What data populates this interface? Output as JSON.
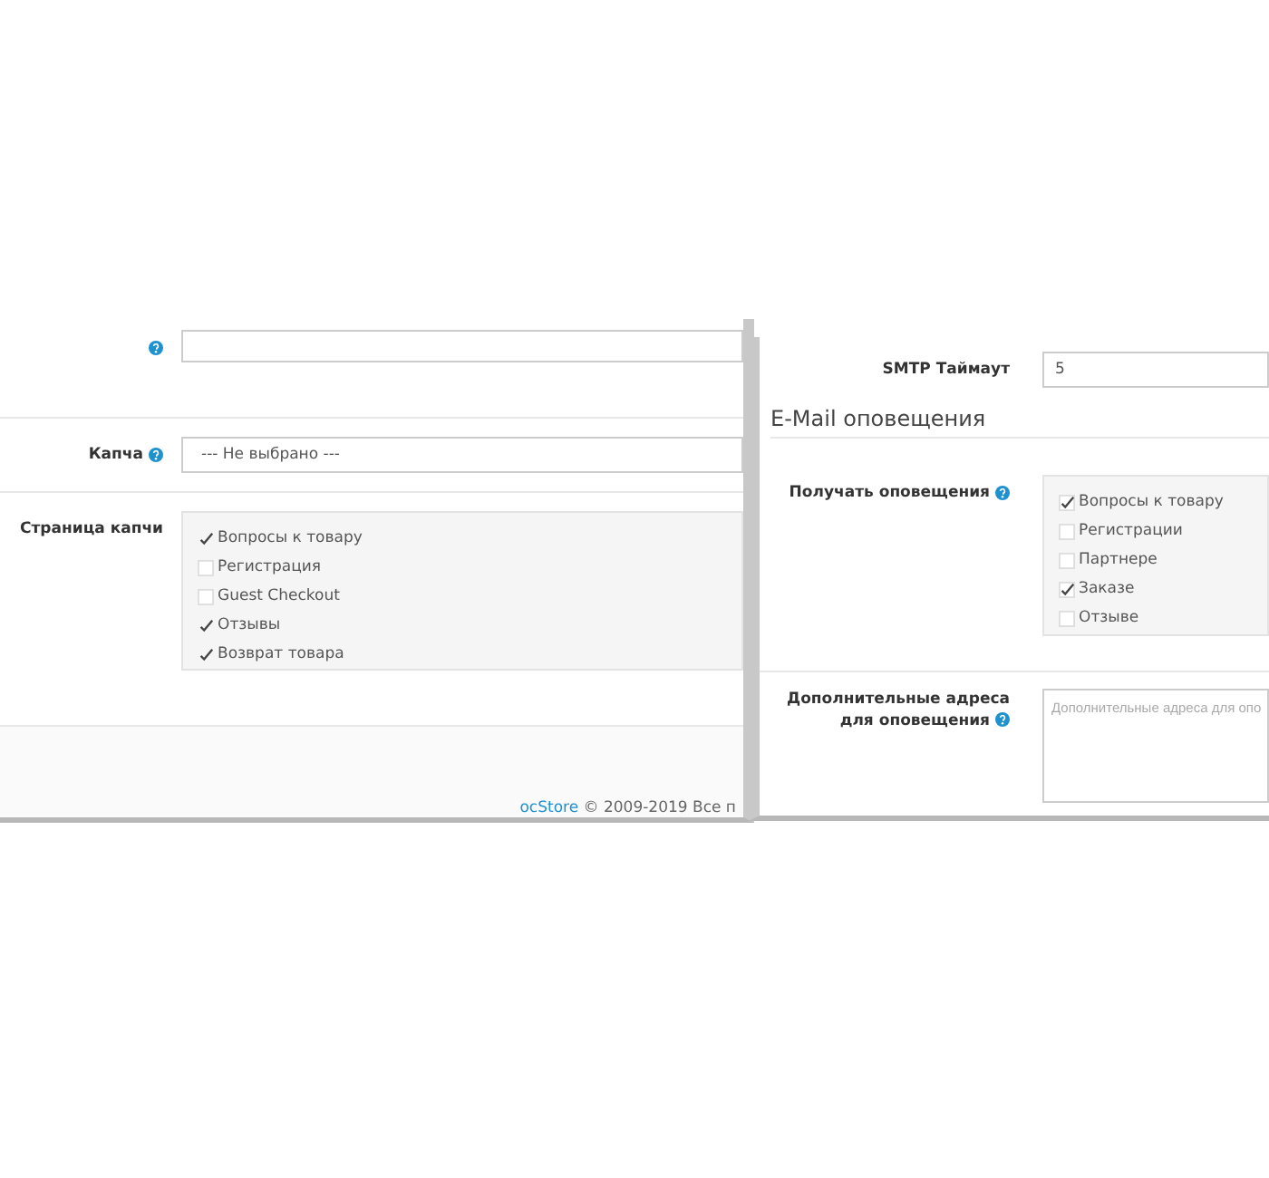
{
  "left_panel": {
    "captcha": {
      "label": "Капча",
      "value": "--- Не выбрано ---"
    },
    "captcha_page": {
      "label": "Страница капчи",
      "options": [
        {
          "label": "Вопросы к товару",
          "checked": true
        },
        {
          "label": "Регистрация",
          "checked": false
        },
        {
          "label": "Guest Checkout",
          "checked": false
        },
        {
          "label": "Отзывы",
          "checked": true
        },
        {
          "label": "Возврат товара",
          "checked": true
        }
      ]
    },
    "footer": {
      "link": "ocStore",
      "text": "© 2009-2019 Все п"
    }
  },
  "right_panel": {
    "smtp_timeout": {
      "label": "SMTP Таймаут",
      "value": "5"
    },
    "section_title": "E-Mail оповещения",
    "notifications": {
      "label": "Получать оповещения",
      "options": [
        {
          "label": "Вопросы к товару",
          "checked": true
        },
        {
          "label": "Регистрации",
          "checked": false
        },
        {
          "label": "Партнере",
          "checked": false
        },
        {
          "label": "Заказе",
          "checked": true
        },
        {
          "label": "Отзыве",
          "checked": false
        }
      ]
    },
    "extra_emails": {
      "label": "Дополнительные адреса для оповещения",
      "placeholder": "Дополнительные адреса для опо"
    }
  }
}
